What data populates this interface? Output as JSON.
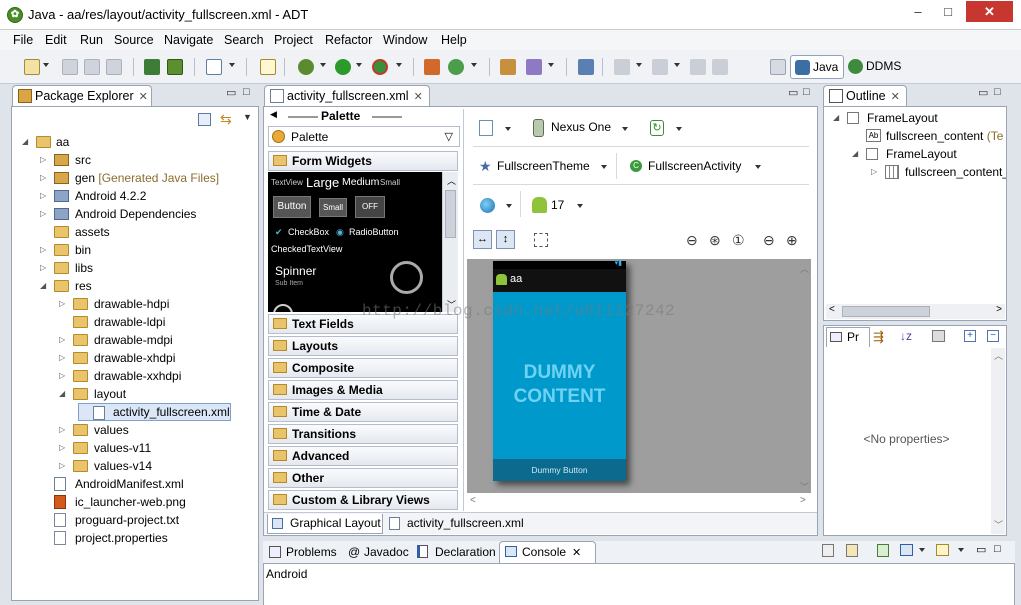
{
  "window": {
    "title": "Java - aa/res/layout/activity_fullscreen.xml - ADT",
    "buttons": {
      "minimize": "–",
      "maximize": "□",
      "close": "✕"
    }
  },
  "menu": [
    "File",
    "Edit",
    "Run",
    "Source",
    "Navigate",
    "Search",
    "Project",
    "Refactor",
    "Window",
    "Help"
  ],
  "perspectives": {
    "java": "Java",
    "ddms": "DDMS"
  },
  "package_explorer": {
    "title": "Package Explorer",
    "tree": [
      {
        "label": "aa"
      },
      {
        "label": "src"
      },
      {
        "label": "gen",
        "suffix": "[Generated Java Files]"
      },
      {
        "label": "Android 4.2.2"
      },
      {
        "label": "Android Dependencies"
      },
      {
        "label": "assets"
      },
      {
        "label": "bin"
      },
      {
        "label": "libs"
      },
      {
        "label": "res"
      },
      {
        "label": "drawable-hdpi"
      },
      {
        "label": "drawable-ldpi"
      },
      {
        "label": "drawable-mdpi"
      },
      {
        "label": "drawable-xhdpi"
      },
      {
        "label": "drawable-xxhdpi"
      },
      {
        "label": "layout"
      },
      {
        "label": "activity_fullscreen.xml"
      },
      {
        "label": "values"
      },
      {
        "label": "values-v11"
      },
      {
        "label": "values-v14"
      },
      {
        "label": "AndroidManifest.xml"
      },
      {
        "label": "ic_launcher-web.png"
      },
      {
        "label": "proguard-project.txt"
      },
      {
        "label": "project.properties"
      }
    ]
  },
  "editor": {
    "tab": "activity_fullscreen.xml",
    "palette_header": "Palette",
    "palette_dropdown": "Palette",
    "palette_categories": [
      "Form Widgets",
      "Text Fields",
      "Layouts",
      "Composite",
      "Images & Media",
      "Time & Date",
      "Transitions",
      "Advanced",
      "Other",
      "Custom & Library Views"
    ],
    "widgets": {
      "textview": "TextView",
      "large": "Large",
      "medium": "Medium",
      "small": "Small",
      "button": "Button",
      "small_button": "Small",
      "toggle": "OFF",
      "checkbox": "CheckBox",
      "radio": "RadioButton",
      "checked_text": "CheckedTextView",
      "spinner": "Spinner",
      "spinner_sub": "Sub Item"
    },
    "device": "Nexus One",
    "theme": "FullscreenTheme",
    "activity": "FullscreenActivity",
    "api_level": "17",
    "preview": {
      "app_name": "aa",
      "content": "DUMMY CONTENT",
      "button": "Dummy Button"
    },
    "bottom_tabs": [
      "Graphical Layout",
      "activity_fullscreen.xml"
    ],
    "watermark": "http://blog.csdn.net/u011127242"
  },
  "outline": {
    "title": "Outline",
    "tree": [
      {
        "label": "FrameLayout"
      },
      {
        "label": "fullscreen_content",
        "suffix": "(Te"
      },
      {
        "label": "FrameLayout"
      },
      {
        "label": "fullscreen_content_"
      }
    ]
  },
  "properties": {
    "tab_short": "Pr",
    "empty": "<No properties>"
  },
  "bottom_panel": {
    "tabs": [
      "Problems",
      "Javadoc",
      "Declaration",
      "Console"
    ],
    "console_text": "Android"
  },
  "colors": {
    "preview_blue": "#0099cc",
    "preview_dark": "#0b6a8e",
    "statusbar": "#000000"
  }
}
